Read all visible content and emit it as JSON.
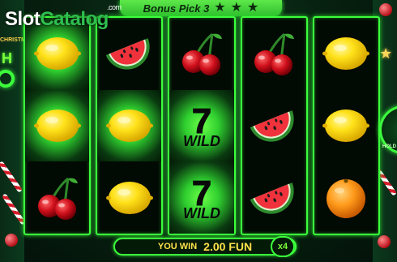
{
  "logo": {
    "prefix": "Slot",
    "suffix": "Catalog",
    "domain": ".com"
  },
  "header": {
    "title": "Bonus Pick 3",
    "stars": [
      "star-icon",
      "star-icon",
      "star-icon"
    ]
  },
  "side": {
    "left_text": "CHRISTMAS",
    "left_letter": "H",
    "hold_label": "HOLD"
  },
  "reels": [
    [
      {
        "symbol": "lemon",
        "win": true
      },
      {
        "symbol": "lemon",
        "win": true
      },
      {
        "symbol": "cherry",
        "win": false
      }
    ],
    [
      {
        "symbol": "watermelon",
        "win": false
      },
      {
        "symbol": "lemon",
        "win": true
      },
      {
        "symbol": "lemon",
        "win": false
      }
    ],
    [
      {
        "symbol": "cherry",
        "win": false
      },
      {
        "symbol": "wild",
        "win": true
      },
      {
        "symbol": "wild",
        "win": true
      }
    ],
    [
      {
        "symbol": "cherry",
        "win": false
      },
      {
        "symbol": "watermelon",
        "win": false
      },
      {
        "symbol": "watermelon",
        "win": false
      }
    ],
    [
      {
        "symbol": "lemon",
        "win": false
      },
      {
        "symbol": "lemon",
        "win": false
      },
      {
        "symbol": "orange",
        "win": false
      }
    ]
  ],
  "wild": {
    "number": "7",
    "label": "WILD"
  },
  "win_bar": {
    "label": "YOU WIN",
    "amount": "2.00 FUN",
    "multiplier": "x4"
  },
  "colors": {
    "frame": "#3cff3c",
    "win_text": "#ffe14a",
    "background": "#07200f"
  }
}
